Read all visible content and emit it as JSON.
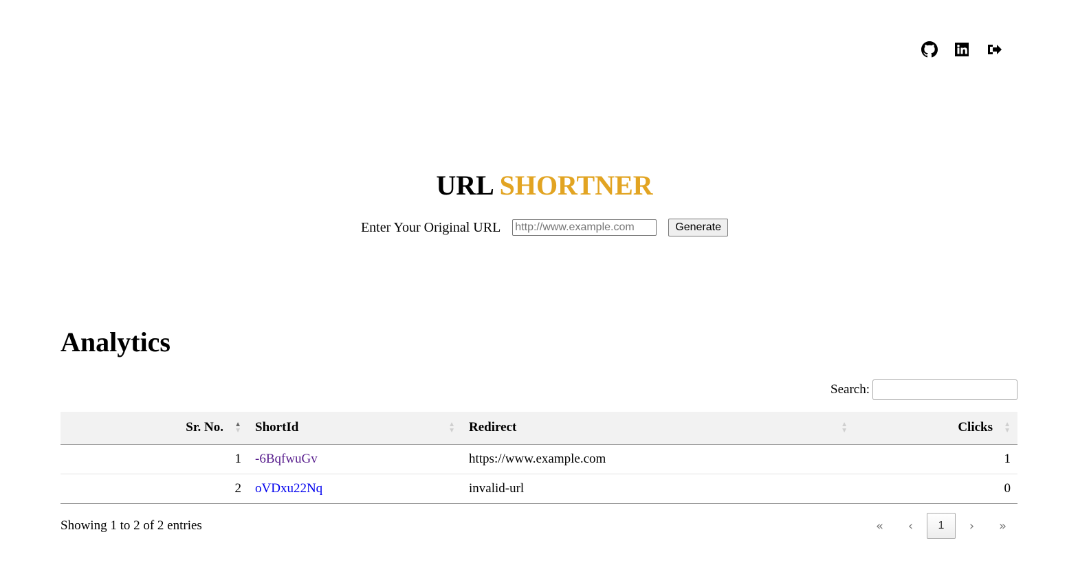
{
  "nav": {
    "icons": [
      "github-icon",
      "linkedin-icon",
      "logout-icon"
    ]
  },
  "hero": {
    "title_plain": "URL",
    "title_accent": "SHORTNER",
    "accent_color": "#e2a422"
  },
  "form": {
    "label": "Enter Your Original URL",
    "placeholder": "http://www.example.com",
    "button": "Generate"
  },
  "analytics": {
    "title": "Analytics",
    "search_label": "Search:",
    "columns": [
      "Sr. No.",
      "ShortId",
      "Redirect",
      "Clicks"
    ],
    "rows": [
      {
        "sr": "1",
        "short_id": "-6BqfwuGv",
        "redirect": "https://www.example.com",
        "clicks": "1"
      },
      {
        "sr": "2",
        "short_id": "oVDxu22Nq",
        "redirect": "invalid-url",
        "clicks": "0"
      }
    ],
    "info": "Showing 1 to 2 of 2 entries",
    "pager": {
      "first": "«",
      "prev": "‹",
      "current": "1",
      "next": "›",
      "last": "»"
    }
  }
}
